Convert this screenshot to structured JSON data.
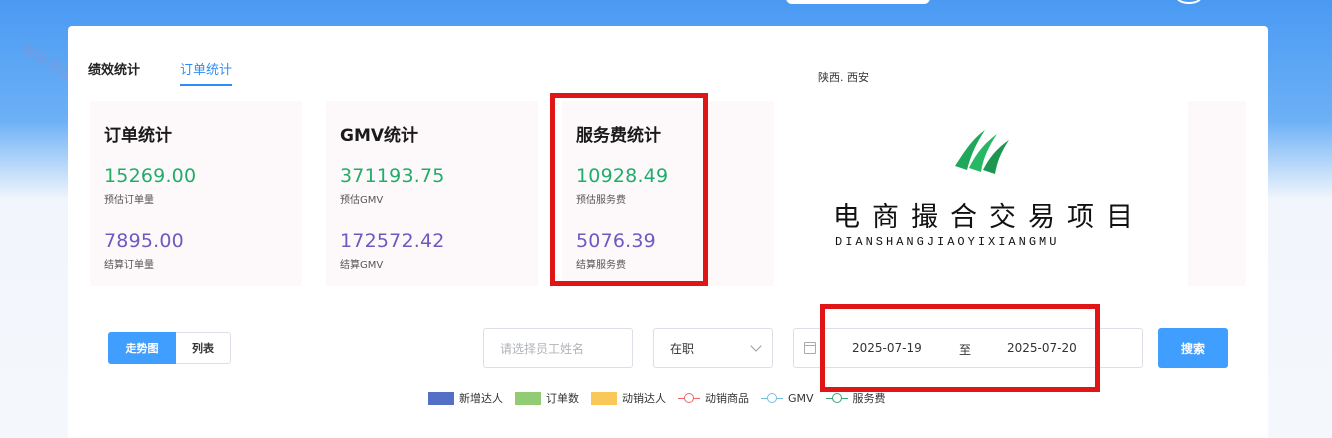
{
  "tabs": [
    {
      "label": "绩效统计",
      "active": false
    },
    {
      "label": "订单统计",
      "active": true
    }
  ],
  "stats": [
    {
      "title": "订单统计",
      "v1": "15269.00",
      "l1": "预估订单量",
      "v2": "7895.00",
      "l2": "结算订单量"
    },
    {
      "title": "GMV统计",
      "v1": "371193.75",
      "l1": "预估GMV",
      "v2": "172572.42",
      "l2": "结算GMV"
    },
    {
      "title": "服务费统计",
      "v1": "10928.49",
      "l1": "预估服务费",
      "v2": "5076.39",
      "l2": "结算服务费"
    }
  ],
  "logo": {
    "region": "陕西. 西安",
    "name_cn": "电商撮合交易项目",
    "name_py": "DIANSHANGJIAOYIXIANGMU"
  },
  "watermark": "陕西·西安",
  "view_toggle": {
    "chart": "走势图",
    "list": "列表",
    "active": "chart"
  },
  "filters": {
    "employee_placeholder": "请选择员工姓名",
    "status": "在职",
    "date_start": "2025-07-19",
    "date_sep": "至",
    "date_end": "2025-07-20",
    "search": "搜索"
  },
  "legend": [
    {
      "label": "新增达人",
      "kind": "bar",
      "color": "#5470c6"
    },
    {
      "label": "订单数",
      "kind": "bar",
      "color": "#91cc75"
    },
    {
      "label": "动销达人",
      "kind": "bar",
      "color": "#fac858"
    },
    {
      "label": "动销商品",
      "kind": "line",
      "color": "#ee6666"
    },
    {
      "label": "GMV",
      "kind": "line",
      "color": "#73c0de"
    },
    {
      "label": "服务费",
      "kind": "line",
      "color": "#3ba272"
    }
  ],
  "colors": {
    "accent": "#409eff",
    "green": "#20ad6a",
    "purple": "#6a5bc0",
    "highlight": "#e01515"
  }
}
